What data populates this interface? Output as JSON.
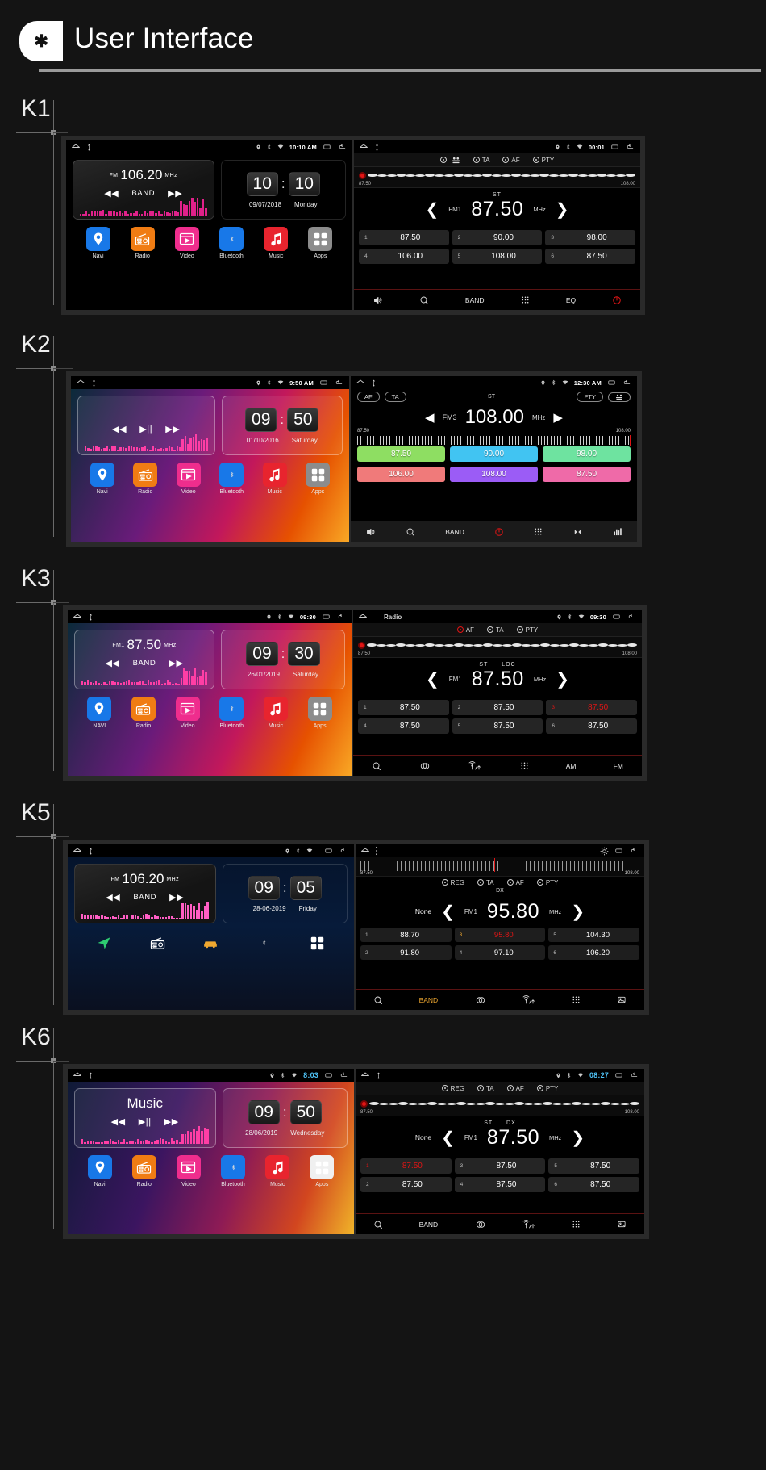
{
  "header": {
    "badge": "✱",
    "title": "User Interface"
  },
  "sections": [
    {
      "id": "K1",
      "label": "K1",
      "home": {
        "statusbar": {
          "time": "10:10 AM",
          "icons": [
            "home-icon",
            "usb-icon",
            "location-icon",
            "bluetooth-icon",
            "wifi-icon",
            "recents-icon",
            "back-icon"
          ]
        },
        "radio_widget": {
          "band": "FM",
          "freq": "106.20",
          "unit": "MHz",
          "band_label": "BAND",
          "prev": "◀◀",
          "next": "▶▶"
        },
        "clock_widget": {
          "hour": "10",
          "colon": ":",
          "minute": "10",
          "date": "09/07/2018",
          "day": "Monday"
        },
        "apps": [
          {
            "label": "Navi",
            "icon": "navi-icon",
            "color": "#1878e8"
          },
          {
            "label": "Radio",
            "icon": "radio-icon",
            "color": "#f07c13"
          },
          {
            "label": "Video",
            "icon": "video-icon",
            "color": "#ef2d8d"
          },
          {
            "label": "Bluetooth",
            "icon": "bluetooth-icon",
            "color": "#1878e8"
          },
          {
            "label": "Music",
            "icon": "music-icon",
            "color": "#e8242e"
          },
          {
            "label": "Apps",
            "icon": "apps-icon",
            "color": "#8c8c8c"
          }
        ]
      },
      "radio": {
        "statusbar": {
          "time": "00:01"
        },
        "rds": [
          "AFI",
          "TA",
          "AF",
          "PTY"
        ],
        "dial": {
          "low": "87.50",
          "high": "108.00"
        },
        "tuner": {
          "st": "ST",
          "band": "FM1",
          "freq": "87.50",
          "unit": "MHz"
        },
        "presets": [
          {
            "n": "1",
            "f": "87.50"
          },
          {
            "n": "2",
            "f": "90.00"
          },
          {
            "n": "3",
            "f": "98.00"
          },
          {
            "n": "4",
            "f": "106.00"
          },
          {
            "n": "5",
            "f": "108.00"
          },
          {
            "n": "6",
            "f": "87.50"
          }
        ],
        "toolbar": [
          {
            "label": "",
            "icon": "volume-icon"
          },
          {
            "label": "",
            "icon": "search-icon"
          },
          {
            "label": "BAND",
            "icon": ""
          },
          {
            "label": "",
            "icon": "keypad-icon"
          },
          {
            "label": "EQ",
            "icon": ""
          },
          {
            "label": "",
            "icon": "power-icon"
          }
        ]
      }
    },
    {
      "id": "K2",
      "label": "K2",
      "home": {
        "statusbar": {
          "time": "9:50 AM"
        },
        "radio_widget": {
          "prev": "◀◀",
          "play": "▶||",
          "next": "▶▶"
        },
        "clock_widget": {
          "hour": "09",
          "colon": ":",
          "minute": "50",
          "date": "01/10/2016",
          "day": "Saturday"
        },
        "apps": [
          {
            "label": "Navi",
            "icon": "navi-icon",
            "color": "#1878e8"
          },
          {
            "label": "Radio",
            "icon": "radio-icon",
            "color": "#f07c13"
          },
          {
            "label": "Video",
            "icon": "video-icon",
            "color": "#ef2d8d"
          },
          {
            "label": "Bluetooth",
            "icon": "bluetooth-icon",
            "color": "#1878e8"
          },
          {
            "label": "Music",
            "icon": "music-icon",
            "color": "#e8242e"
          },
          {
            "label": "Apps",
            "icon": "apps-icon",
            "color": "#8c8c8c"
          }
        ]
      },
      "radio": {
        "statusbar": {
          "time": "12:30 AM"
        },
        "chips_left": [
          "AF",
          "TA"
        ],
        "chips_right": [
          "PTY",
          "AFI"
        ],
        "tuner": {
          "st": "ST",
          "band": "FM3",
          "freq": "108.00",
          "unit": "MHz",
          "prev": "◀",
          "next": "▶"
        },
        "dial": {
          "low": "87.50",
          "high": "108.00"
        },
        "presets": [
          {
            "f": "87.50",
            "color": "#8ede62"
          },
          {
            "f": "90.00",
            "color": "#41c4f2"
          },
          {
            "f": "98.00",
            "color": "#6ee3a0"
          },
          {
            "f": "106.00",
            "color": "#f07a7a"
          },
          {
            "f": "108.00",
            "color": "#9b5cf6"
          },
          {
            "f": "87.50",
            "color": "#ef6aa8"
          }
        ],
        "toolbar": [
          {
            "label": "",
            "icon": "volume-icon"
          },
          {
            "label": "",
            "icon": "search-icon"
          },
          {
            "label": "BAND",
            "icon": ""
          },
          {
            "label": "",
            "icon": "power-icon"
          },
          {
            "label": "",
            "icon": "keypad-icon"
          },
          {
            "label": "",
            "icon": "skip-icon"
          },
          {
            "label": "",
            "icon": "equalizer-icon"
          }
        ]
      }
    },
    {
      "id": "K3",
      "label": "K3",
      "home": {
        "statusbar": {
          "time": "09:30"
        },
        "radio_widget": {
          "band": "FM1",
          "freq": "87.50",
          "unit": "MHz",
          "band_label": "BAND",
          "prev": "◀◀",
          "next": "▶▶"
        },
        "clock_widget": {
          "hour": "09",
          "colon": ":",
          "minute": "30",
          "date": "26/01/2019",
          "day": "Saturday"
        },
        "apps": [
          {
            "label": "NAVI",
            "icon": "navi-icon",
            "color": "#1878e8"
          },
          {
            "label": "Radio",
            "icon": "radio-icon",
            "color": "#f07c13"
          },
          {
            "label": "Video",
            "icon": "video-icon",
            "color": "#ef2d8d"
          },
          {
            "label": "Bluetooth",
            "icon": "bluetooth-icon",
            "color": "#1878e8"
          },
          {
            "label": "Music",
            "icon": "music-icon",
            "color": "#e8242e"
          },
          {
            "label": "Apps",
            "icon": "apps-icon",
            "color": "#8c8c8c"
          }
        ]
      },
      "radio": {
        "statusbar": {
          "title": "Radio",
          "time": "09:30"
        },
        "rds": [
          "AF",
          "TA",
          "PTY"
        ],
        "dial": {
          "low": "87.50",
          "high": "108.00"
        },
        "tuner": {
          "st": "ST",
          "loc": "LOC",
          "band": "FM1",
          "freq": "87.50",
          "unit": "MHz"
        },
        "presets": [
          {
            "n": "1",
            "f": "87.50"
          },
          {
            "n": "2",
            "f": "87.50"
          },
          {
            "n": "3",
            "f": "87.50",
            "active": true
          },
          {
            "n": "4",
            "f": "87.50"
          },
          {
            "n": "5",
            "f": "87.50"
          },
          {
            "n": "6",
            "f": "87.50"
          }
        ],
        "toolbar": [
          {
            "label": "",
            "icon": "search-icon"
          },
          {
            "label": "",
            "icon": "stereo-icon"
          },
          {
            "label": "",
            "icon": "dx-loc-icon"
          },
          {
            "label": "",
            "icon": "keypad-icon"
          },
          {
            "label": "AM",
            "icon": ""
          },
          {
            "label": "FM",
            "icon": ""
          }
        ]
      }
    },
    {
      "id": "K5",
      "label": "K5",
      "home": {
        "statusbar": {
          "icons": [
            "home-icon",
            "menu-icon",
            "brightness-icon",
            "recents-icon",
            "back-icon"
          ]
        },
        "radio_widget": {
          "band": "FM",
          "freq": "106.20",
          "unit": "MHz",
          "band_label": "BAND",
          "prev": "◀◀",
          "next": "▶▶"
        },
        "clock_widget": {
          "hour": "09",
          "colon": ":",
          "minute": "05",
          "date": "28-06-2019",
          "day": "Friday"
        },
        "apps": [
          {
            "label": "",
            "icon": "navi-arrow-icon",
            "color": "#2ecc71"
          },
          {
            "label": "",
            "icon": "radio-icon",
            "color": "#1aa3a3"
          },
          {
            "label": "",
            "icon": "car-icon",
            "color": "#f0a830"
          },
          {
            "label": "",
            "icon": "bluetooth-icon",
            "color": "#2a86e0"
          },
          {
            "label": "",
            "icon": "apps-icon",
            "color": "#e0218a"
          }
        ]
      },
      "radio": {
        "statusbar": {
          "icons": [
            "home-icon",
            "menu-icon",
            "brightness-icon",
            "recents-icon",
            "back-icon"
          ]
        },
        "dial": {
          "low": "87.50",
          "high": "108.00"
        },
        "rds": [
          "REG",
          "TA",
          "AF",
          "PTY"
        ],
        "rds2": [
          "DX"
        ],
        "tuner": {
          "none": "None",
          "band": "FM1",
          "freq": "95.80",
          "unit": "MHz"
        },
        "presets": [
          {
            "n": "1",
            "f": "88.70"
          },
          {
            "n": "3",
            "f": "95.80",
            "active": true
          },
          {
            "n": "5",
            "f": "104.30"
          },
          {
            "n": "2",
            "f": "91.80"
          },
          {
            "n": "4",
            "f": "97.10"
          },
          {
            "n": "6",
            "f": "106.20"
          }
        ],
        "toolbar": [
          {
            "label": "",
            "icon": "search-icon"
          },
          {
            "label": "BAND",
            "icon": ""
          },
          {
            "label": "",
            "icon": "stereo-icon"
          },
          {
            "label": "",
            "icon": "dx-loc-icon"
          },
          {
            "label": "",
            "icon": "keypad-icon"
          },
          {
            "label": "",
            "icon": "image-icon"
          }
        ]
      }
    },
    {
      "id": "K6",
      "label": "K6",
      "home": {
        "statusbar": {
          "time": "8:03",
          "icons": [
            "back-icon",
            "home-icon",
            "recents-icon",
            "bluetooth-icon"
          ]
        },
        "radio_widget": {
          "title": "Music",
          "prev": "◀◀",
          "play": "▶||",
          "next": "▶▶"
        },
        "clock_widget": {
          "hour": "09",
          "colon": ":",
          "minute": "50",
          "date": "28/06/2019",
          "day": "Wednesday"
        },
        "apps": [
          {
            "label": "Navi",
            "icon": "navi-icon",
            "color": "#1878e8"
          },
          {
            "label": "Radio",
            "icon": "radio-icon",
            "color": "#f07c13"
          },
          {
            "label": "Video",
            "icon": "video-icon",
            "color": "#ef2d8d"
          },
          {
            "label": "Bluetooth",
            "icon": "bluetooth-icon",
            "color": "#1878e8"
          },
          {
            "label": "Music",
            "icon": "music-icon",
            "color": "#e8242e"
          },
          {
            "label": "Apps",
            "icon": "apps-icon",
            "color": "#f0f0f0"
          }
        ]
      },
      "radio": {
        "statusbar": {
          "time": "08:27"
        },
        "rds": [
          "REG",
          "TA",
          "AF",
          "PTY"
        ],
        "dial": {
          "low": "87.50",
          "high": "108.00"
        },
        "tuner": {
          "none": "None",
          "st": "ST",
          "dx": "DX",
          "band": "FM1",
          "freq": "87.50",
          "unit": "MHz"
        },
        "presets": [
          {
            "n": "1",
            "f": "87.50",
            "active": true
          },
          {
            "n": "3",
            "f": "87.50"
          },
          {
            "n": "5",
            "f": "87.50"
          },
          {
            "n": "2",
            "f": "87.50"
          },
          {
            "n": "4",
            "f": "87.50"
          },
          {
            "n": "6",
            "f": "87.50"
          }
        ],
        "toolbar": [
          {
            "label": "",
            "icon": "search-icon"
          },
          {
            "label": "BAND",
            "icon": ""
          },
          {
            "label": "",
            "icon": "stereo-icon"
          },
          {
            "label": "",
            "icon": "dx-loc-icon"
          },
          {
            "label": "",
            "icon": "keypad-icon"
          },
          {
            "label": "",
            "icon": "image-icon"
          }
        ]
      }
    }
  ]
}
